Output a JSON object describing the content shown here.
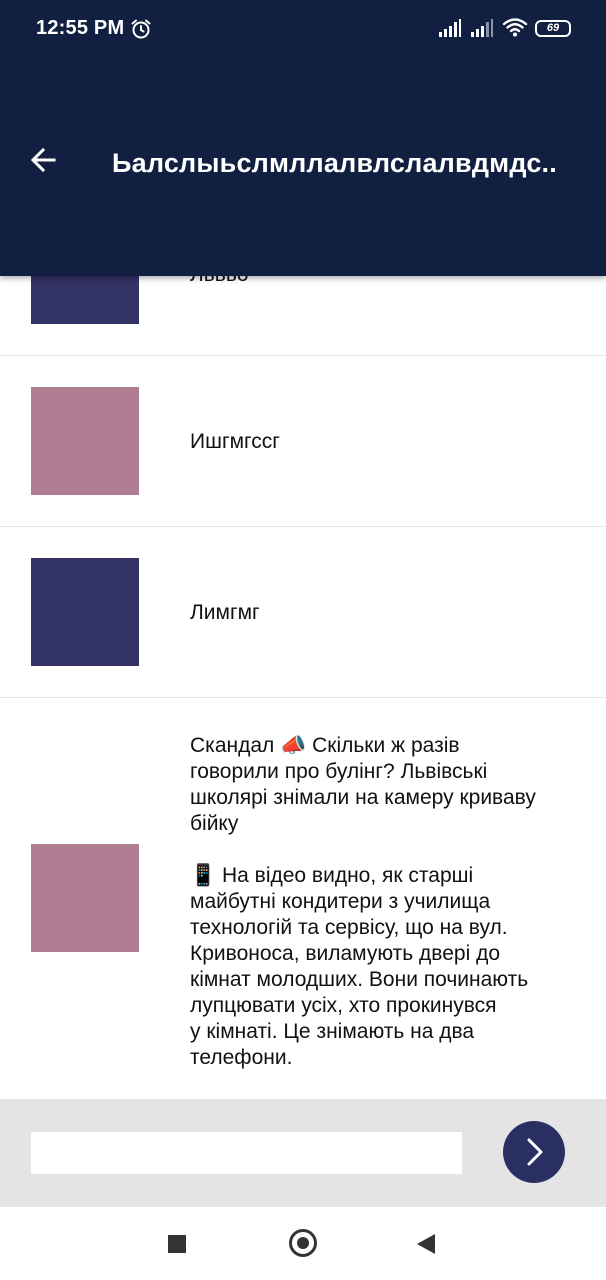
{
  "status_bar": {
    "time": "12:55 PM",
    "battery": "69"
  },
  "header": {
    "title": "Ьалслыьслмллалвлслалвдмдс..",
    "background": "#111f41"
  },
  "messages": [
    {
      "text": "Львьо",
      "thumb_color": "#343366"
    },
    {
      "text": "Ишгмгссг",
      "thumb_color": "#af7d91"
    },
    {
      "text": "Лимгмг",
      "thumb_color": "#343366"
    },
    {
      "text_lines": [
        "Скандал 📣 Скільки ж разів",
        "говорили про булінг? Львівські",
        "школярі знімали на камеру криваву",
        "бійку",
        "",
        "📱 На відео видно, як старші",
        "майбутні кондитери з  училища",
        "технологій та сервісу, що на вул.",
        "Кривоноса, виламують двері до",
        "кімнат молодших. Вони починають",
        "лупцювати усіх, хто прокинувся",
        "у кімнаті. Це знімають на два",
        "телефони."
      ],
      "thumb_color": "#af7d91"
    }
  ],
  "composer": {
    "input_value": "",
    "input_placeholder": "",
    "send_color": "#2a2f63"
  }
}
